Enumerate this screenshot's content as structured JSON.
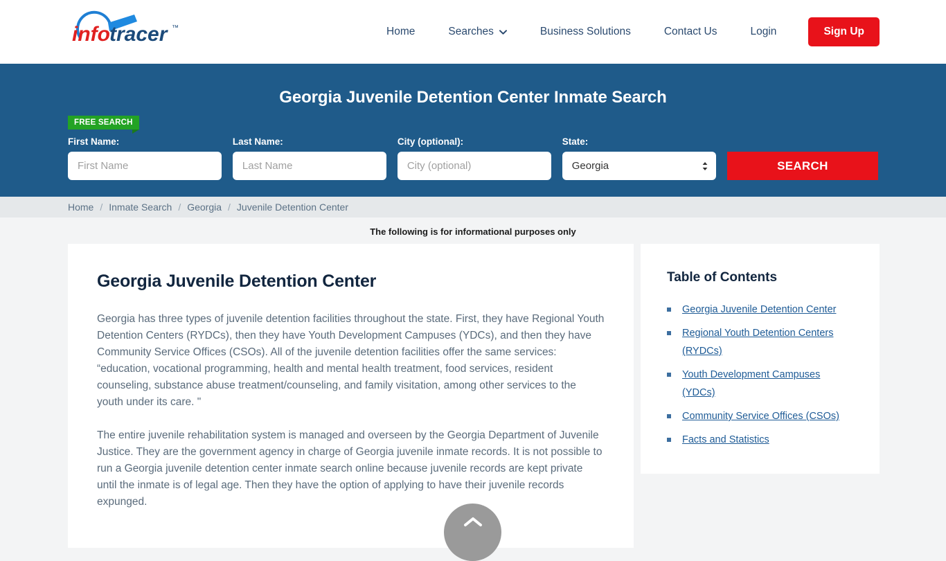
{
  "header": {
    "logo": {
      "name": "infotracer-logo",
      "part1": "info",
      "part2": "tracer",
      "tm": "™"
    },
    "nav": [
      {
        "label": "Home",
        "name": "nav-home",
        "has_chevron": false
      },
      {
        "label": "Searches",
        "name": "nav-searches",
        "has_chevron": true,
        "chevron_icon": "chevron-down-icon"
      },
      {
        "label": "Business Solutions",
        "name": "nav-business-solutions",
        "has_chevron": false
      },
      {
        "label": "Contact Us",
        "name": "nav-contact-us",
        "has_chevron": false
      },
      {
        "label": "Login",
        "name": "nav-login",
        "has_chevron": false
      }
    ],
    "signup_label": "Sign Up"
  },
  "banner": {
    "title": "Georgia Juvenile Detention Center Inmate Search",
    "free_badge": "FREE SEARCH",
    "fields": {
      "first_name": {
        "label": "First Name:",
        "placeholder": "First Name",
        "value": ""
      },
      "last_name": {
        "label": "Last Name:",
        "placeholder": "Last Name",
        "value": ""
      },
      "city": {
        "label": "City (optional):",
        "placeholder": "City (optional)",
        "value": ""
      },
      "state": {
        "label": "State:",
        "value": "Georgia",
        "options": [
          "Georgia"
        ]
      }
    },
    "submit_label": "SEARCH"
  },
  "breadcrumb": {
    "separator": "/",
    "items": [
      {
        "label": "Home",
        "name": "breadcrumb-home",
        "current": false
      },
      {
        "label": "Inmate Search",
        "name": "breadcrumb-inmate-search",
        "current": false
      },
      {
        "label": "Georgia",
        "name": "breadcrumb-georgia",
        "current": false
      },
      {
        "label": "Juvenile Detention Center",
        "name": "breadcrumb-juvenile-detention-center",
        "current": true
      }
    ]
  },
  "notice": "The following is for informational purposes only",
  "article": {
    "title": "Georgia Juvenile Detention Center",
    "paragraphs": [
      "Georgia has three types of juvenile detention facilities throughout the state. First, they have Regional Youth Detention Centers (RYDCs), then they have Youth Development Campuses (YDCs), and then they have Community Service Offices (CSOs). All of the juvenile detention facilities offer the same services: “education, vocational programming, health and mental health treatment, food services, resident counseling, substance abuse treatment/counseling, and family visitation, among other services to the youth under its care. \"",
      "The entire juvenile rehabilitation system is managed and overseen by the Georgia Department of Juvenile Justice. They are the government agency in charge of Georgia juvenile inmate records. It is not possible to run a Georgia juvenile detention center inmate search online because juvenile records are kept private until the inmate is of legal age. Then they have the option of applying to have their juvenile records expunged."
    ]
  },
  "toc": {
    "title": "Table of Contents",
    "items": [
      {
        "label": "Georgia Juvenile Detention Center",
        "name": "toc-link-georgia-juvenile-detention-center"
      },
      {
        "label": "Regional Youth Detention Centers (RYDCs)",
        "name": "toc-link-regional-youth-detention-centers"
      },
      {
        "label": "Youth Development Campuses (YDCs)",
        "name": "toc-link-youth-development-campuses"
      },
      {
        "label": "Community Service Offices (CSOs)",
        "name": "toc-link-community-service-offices"
      },
      {
        "label": "Facts and Statistics",
        "name": "toc-link-facts-and-statistics"
      }
    ]
  },
  "scroll_top": {
    "icon": "chevron-up-icon",
    "name": "scroll-to-top-button"
  },
  "colors": {
    "banner_blue": "#1f5b8a",
    "accent_red": "#e8121a",
    "badge_green": "#23a324",
    "link_blue": "#1e5b96",
    "page_background": "#f3f4f5",
    "breadcrumb_background": "#e5e8ea",
    "heading_navy": "#12263f",
    "body_text": "#5a6b7b"
  }
}
